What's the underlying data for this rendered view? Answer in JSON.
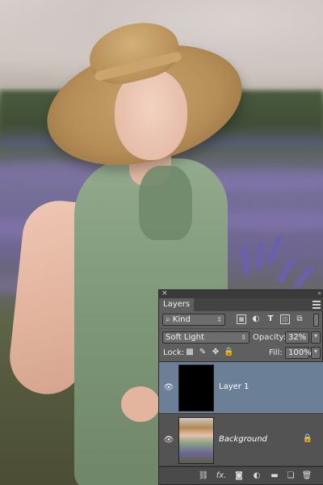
{
  "panel": {
    "close_glyph": "×",
    "collapse_glyph": "»",
    "tab_label": "Layers",
    "filter": {
      "selected": "Kind",
      "search_glyph": "⌕"
    },
    "blend_mode": "Soft Light",
    "opacity_label": "Opacity:",
    "opacity_value": "32%",
    "lock_label": "Lock:",
    "fill_label": "Fill:",
    "fill_value": "100%",
    "layers": [
      {
        "name": "Layer 1",
        "active": true,
        "visible": true,
        "thumbnail": "black-fill"
      },
      {
        "name": "Background",
        "active": false,
        "visible": true,
        "locked": true,
        "thumbnail": "photo"
      }
    ],
    "bottom_bar_icons": [
      "link-icon",
      "fx-icon",
      "mask-icon",
      "adjustment-icon",
      "folder-icon",
      "new-layer-icon",
      "trash-icon"
    ],
    "fx_label": "fx."
  },
  "colors": {
    "panel_bg": "#5f5f5f",
    "active_layer": "#6b7f96",
    "list_bg": "#535353"
  }
}
